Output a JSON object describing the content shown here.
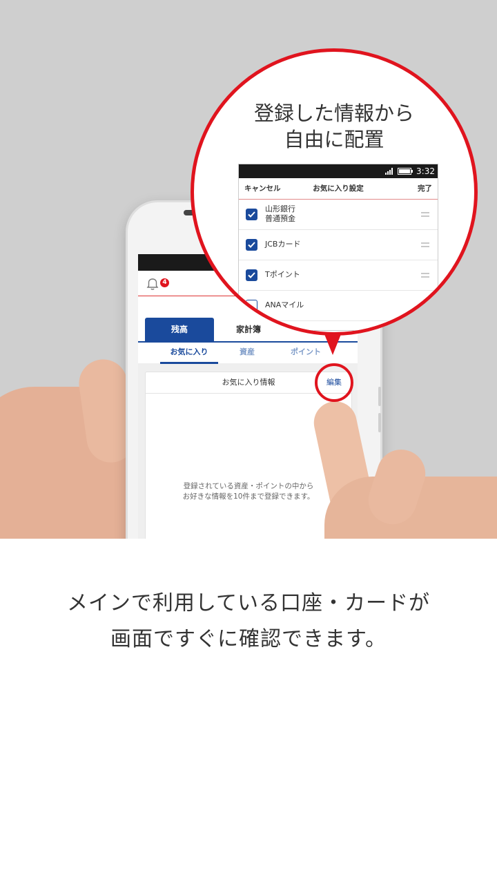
{
  "zoom": {
    "title_line1": "登録した情報から",
    "title_line2": "自由に配置",
    "status_time": "3:32",
    "header": {
      "cancel": "キャンセル",
      "title": "お気に入り設定",
      "done": "完了"
    },
    "items": [
      {
        "line1": "山形銀行",
        "line2": "普通預金",
        "checked": true
      },
      {
        "line1": "JCBカード",
        "line2": "",
        "checked": true
      },
      {
        "line1": "Tポイント",
        "line2": "",
        "checked": true
      },
      {
        "line1": "ANAマイル",
        "line2": "",
        "checked": false
      }
    ]
  },
  "app": {
    "notification_count": "4",
    "tabs": [
      "残高",
      "家計簿"
    ],
    "subtabs": [
      "お気に入り",
      "資産",
      "ポイント"
    ],
    "panel_title": "お気に入り情報",
    "edit_label": "編集",
    "empty_line1": "登録されている資産・ポイントの中から",
    "empty_line2": "お好きな情報を10件まで登録できます。"
  },
  "caption": {
    "line1": "メインで利用している口座・カードが",
    "line2": "画面ですぐに確認できます。"
  },
  "colors": {
    "accent_red": "#e0141e",
    "brand_blue": "#1a4a9c",
    "background_gray": "#cfcfcf"
  }
}
